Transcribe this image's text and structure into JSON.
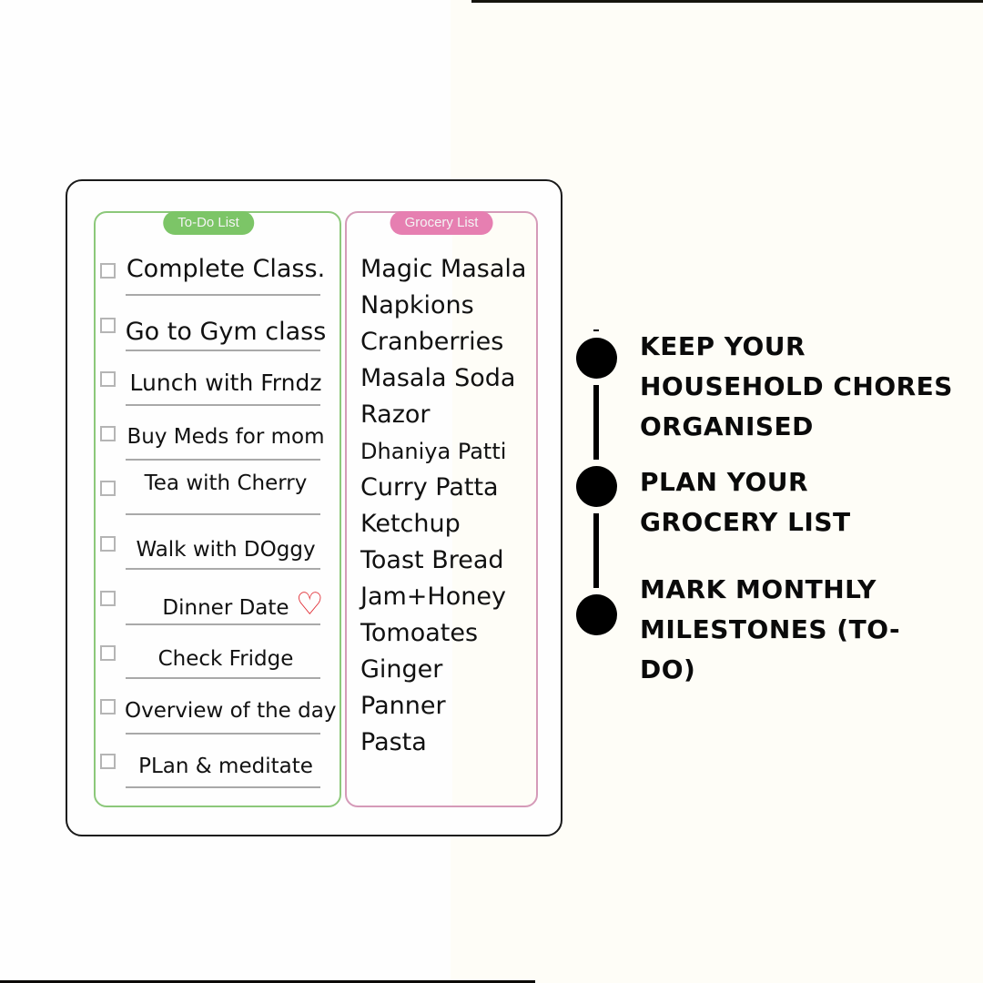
{
  "todo_list": {
    "title": "To-Do List",
    "items": [
      {
        "label": "Complete Class.",
        "checked": false
      },
      {
        "label": "Go to Gym class",
        "checked": false
      },
      {
        "label": "Lunch with Frndz",
        "checked": false
      },
      {
        "label": "Buy Meds for mom",
        "checked": false
      },
      {
        "label": "Tea with Cherry",
        "checked": false
      },
      {
        "label": "Walk with DOggy",
        "checked": false
      },
      {
        "label": "Dinner Date",
        "checked": false,
        "icon": "heart-icon"
      },
      {
        "label": "Check Fridge",
        "checked": false
      },
      {
        "label": "Overview of the day",
        "checked": false
      },
      {
        "label": "PLan & meditate",
        "checked": false
      }
    ]
  },
  "grocery_list": {
    "title": "Grocery List",
    "items": [
      "Magic Masala",
      "Napkions",
      "Cranberries",
      "Masala Soda",
      "Razor",
      "Dhaniya Patti",
      "Curry Patta",
      "Ketchup",
      "Toast Bread",
      "Jam+Honey",
      "Tomoates",
      "Ginger",
      "Panner",
      "Pasta"
    ]
  },
  "timeline": {
    "steps": [
      {
        "text": "KEEP YOUR HOUSEHOLD CHORES ORGANISED"
      },
      {
        "text": "PLAN YOUR GROCERY LIST"
      },
      {
        "text": "MARK MONTHLY MILESTONES (TO-DO)"
      }
    ]
  },
  "colors": {
    "todo_accent": "#7cc567",
    "grocery_accent": "#e67fb1",
    "heart": "#e0272f",
    "background_left": "#fefefe",
    "background_right": "#fefdf7"
  }
}
